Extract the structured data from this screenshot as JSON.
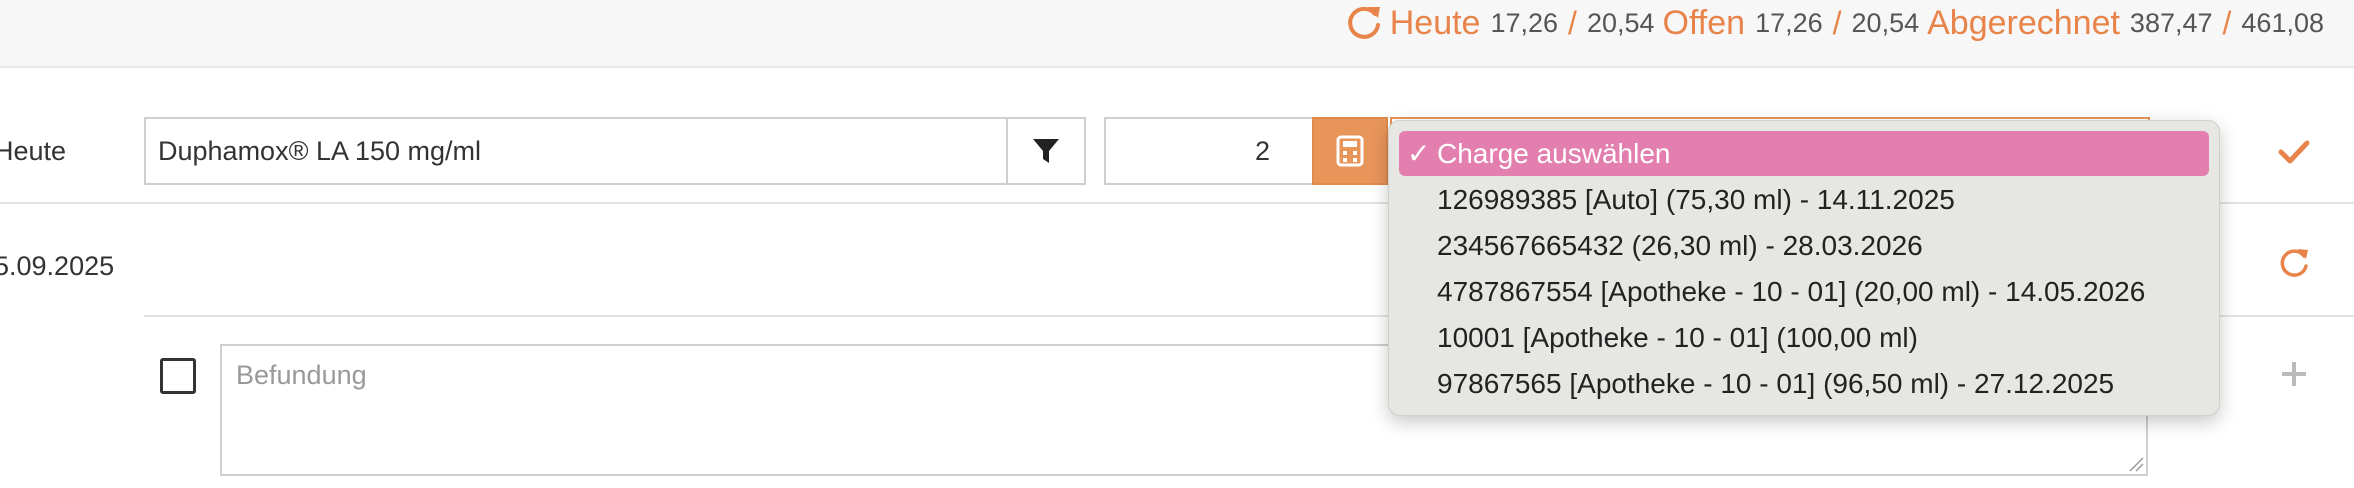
{
  "summary": {
    "heute_label": "Heute",
    "heute_val1": "17,26",
    "heute_val2": "20,54",
    "offen_label": "Offen",
    "offen_val1": "17,26",
    "offen_val2": "20,54",
    "abgerechnet_label": "Abgerechnet",
    "abgerechnet_val1": "387,47",
    "abgerechnet_val2": "461,08",
    "slash": "/",
    "refresh_icon": "refresh-icon"
  },
  "row1": {
    "label": "Heute",
    "product_value": "Duphamox® LA 150 mg/ml",
    "filter_icon": "filter-icon",
    "quantity_value": "2",
    "calculator_icon": "calculator-icon",
    "confirm_icon": "check-icon"
  },
  "row2": {
    "date": "5.09.2025",
    "reload_icon": "refresh-icon"
  },
  "row3": {
    "befund_placeholder": "Befundung",
    "add_icon": "plus-icon"
  },
  "charge_dropdown": {
    "selected_mark": "✓",
    "options": [
      "Charge auswählen",
      "126989385 [Auto] (75,30 ml) - 14.11.2025",
      "234567665432 (26,30 ml) - 28.03.2026",
      "4787867554 [Apotheke - 10 - 01] (20,00 ml) - 14.05.2026",
      "10001 [Apotheke - 10 - 01] (100,00 ml)",
      "97867565 [Apotheke - 10 - 01] (96,50 ml) - 27.12.2025"
    ]
  },
  "colors": {
    "accent": "#e8844a",
    "selected_option": "#e27fae"
  }
}
